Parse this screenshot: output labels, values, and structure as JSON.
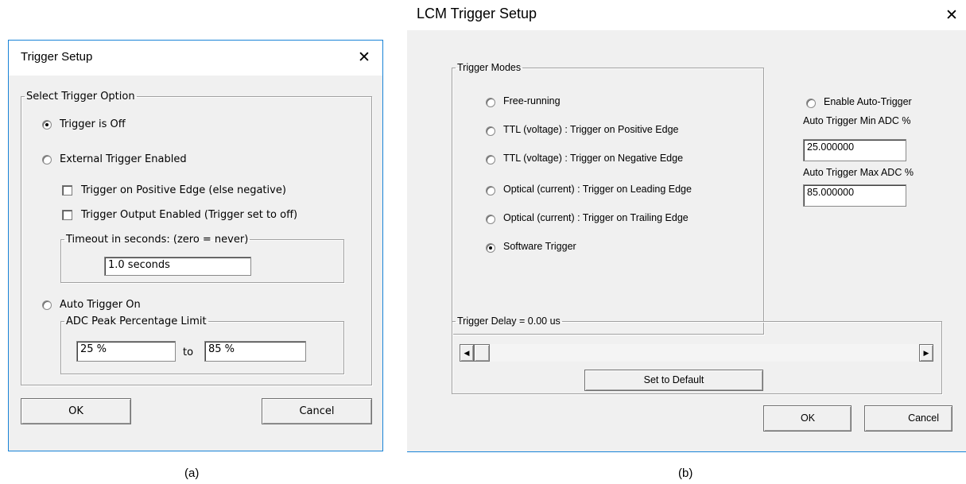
{
  "dialog_a": {
    "title": "Trigger Setup",
    "close_glyph": "✕",
    "group_title": "Select Trigger Option",
    "options": {
      "trigger_off": "Trigger is Off",
      "external": "External Trigger Enabled",
      "auto": "Auto Trigger On"
    },
    "selected_option": "trigger_off",
    "checkboxes": {
      "positive_edge": "Trigger on Positive Edge (else negative)",
      "output_enabled": "Trigger Output Enabled  (Trigger set to off)"
    },
    "timeout": {
      "group_title": "Timeout in seconds:  (zero = never)",
      "value": "1.0 seconds"
    },
    "adc_limit": {
      "group_title": "ADC Peak Percentage Limit",
      "min_value": "25 %",
      "to_label": "to",
      "max_value": "85 %"
    },
    "ok_label": "OK",
    "cancel_label": "Cancel",
    "caption": "(a)"
  },
  "dialog_b": {
    "title": "LCM Trigger Setup",
    "close_glyph": "✕",
    "modes_group_title": "Trigger Modes",
    "modes": [
      "Free-running",
      "TTL (voltage) : Trigger on Positive Edge",
      "TTL (voltage) : Trigger on Negative Edge",
      "Optical (current) : Trigger on Leading Edge",
      "Optical (current) : Trigger on Trailing Edge",
      "Software Trigger"
    ],
    "selected_mode": "Software Trigger",
    "auto_trigger": {
      "enable_label": "Enable Auto-Trigger",
      "min_label": "Auto Trigger Min ADC %",
      "min_value": "25.000000",
      "max_label": "Auto Trigger Max ADC %",
      "max_value": "85.000000"
    },
    "delay": {
      "group_title": "Trigger Delay = 0.00 us",
      "slider_level": 0,
      "default_label": "Set to Default"
    },
    "ok_label": "OK",
    "cancel_label": "Cancel",
    "caption": "(b)"
  }
}
